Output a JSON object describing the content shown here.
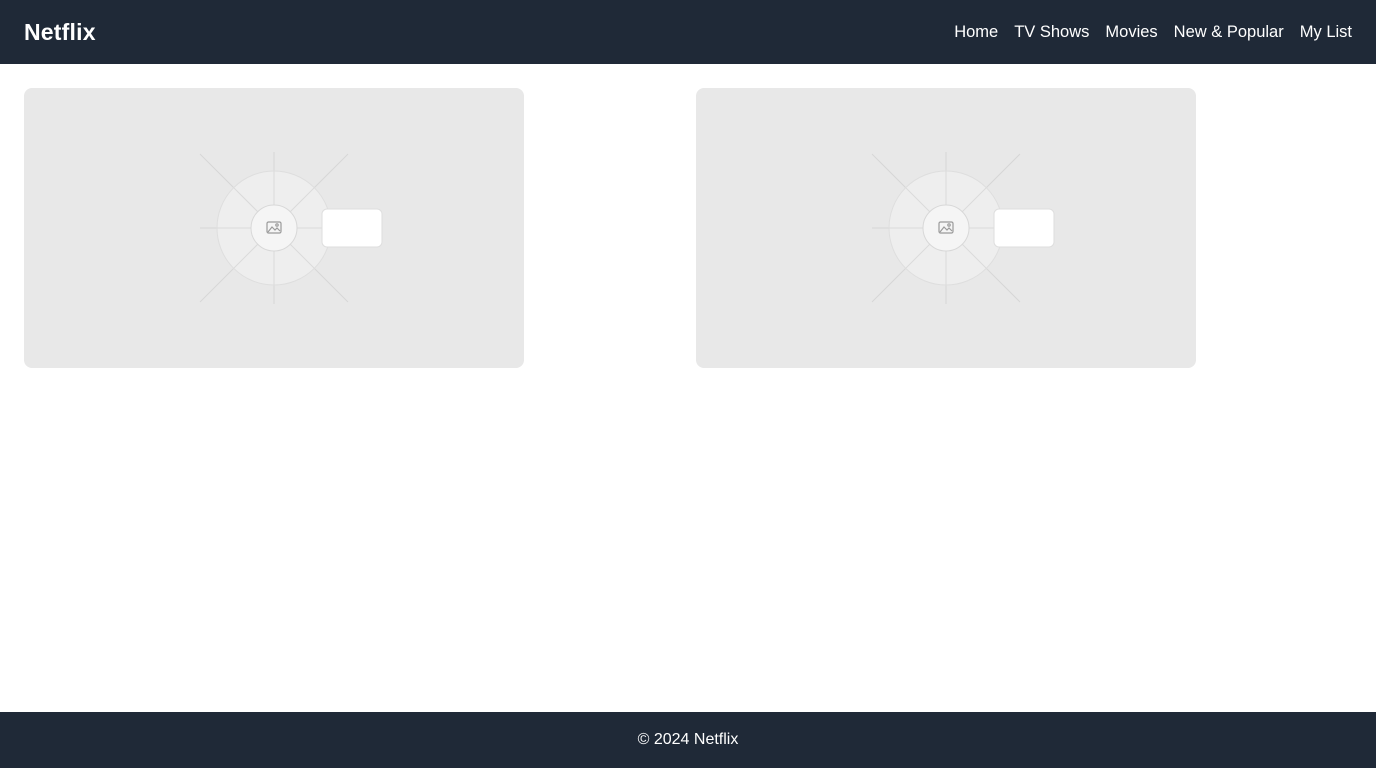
{
  "header": {
    "brand": "Netflix",
    "nav": [
      {
        "label": "Home"
      },
      {
        "label": "TV Shows"
      },
      {
        "label": "Movies"
      },
      {
        "label": "New & Popular"
      },
      {
        "label": "My List"
      }
    ]
  },
  "main": {
    "cards": [
      {
        "icon": "image-placeholder-icon"
      },
      {
        "icon": "image-placeholder-icon"
      }
    ]
  },
  "footer": {
    "text": "© 2024 Netflix"
  },
  "colors": {
    "header_bg": "#1f2937",
    "footer_bg": "#1f2937",
    "card_bg": "#e8e8e8",
    "text_light": "#ffffff"
  }
}
